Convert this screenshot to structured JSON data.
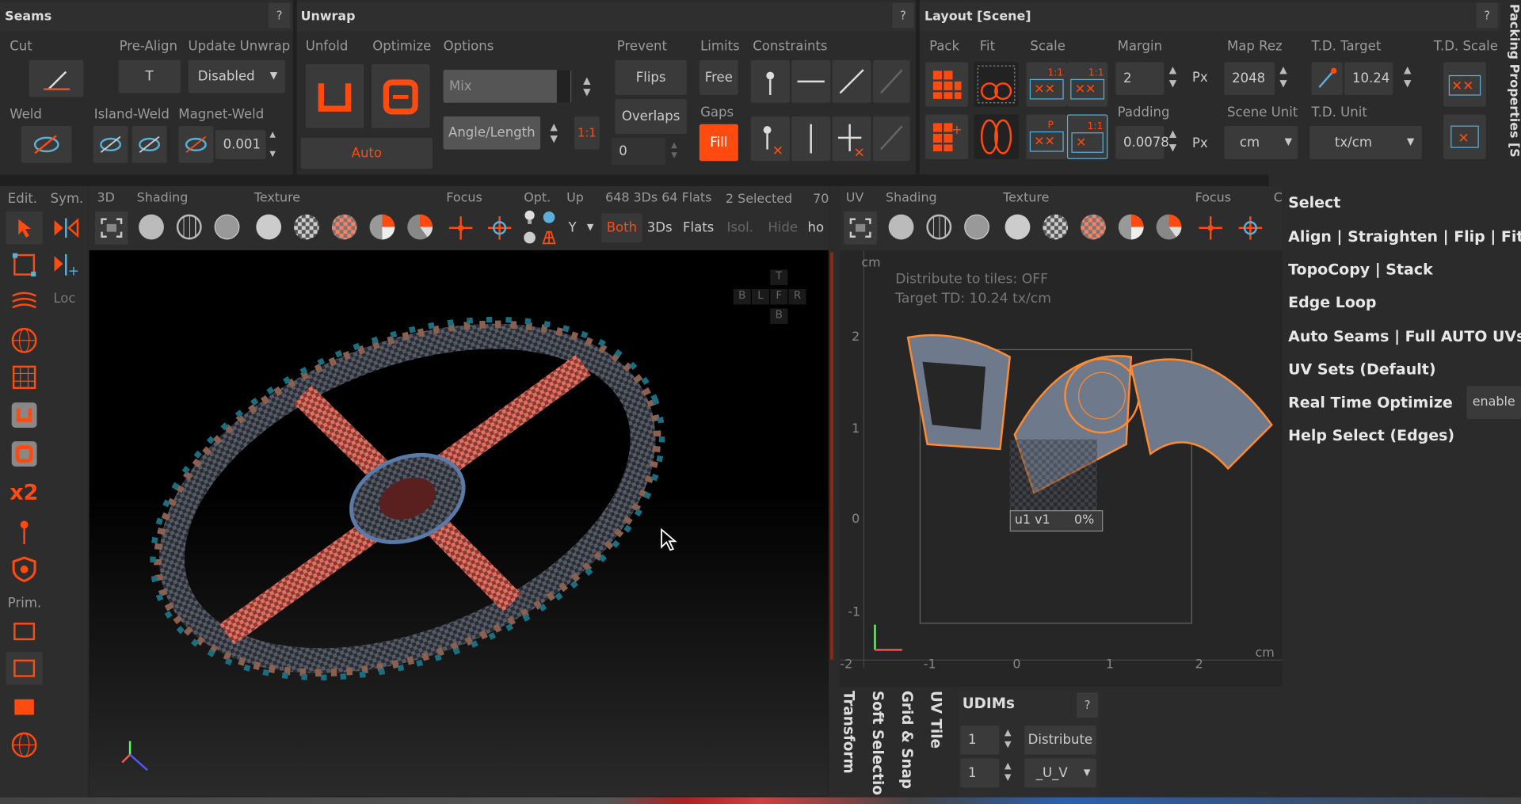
{
  "panels": {
    "seams": "Seams",
    "unwrap": "Unwrap",
    "layout": "Layout [Scene]",
    "packing": "Packing Properties [S",
    "help": "?"
  },
  "seams": {
    "cut": "Cut",
    "pre_align": "Pre-Align",
    "pre_align_value": "T",
    "update_unwrap": "Update Unwrap",
    "update_value": "Disabled",
    "weld": "Weld",
    "island_weld": "Island-Weld",
    "magnet_weld": "Magnet-Weld",
    "magnet_value": "0.001"
  },
  "unwrap": {
    "unfold": "Unfold",
    "optimize": "Optimize",
    "options": "Options",
    "mix": "Mix",
    "angle_length": "Angle/Length",
    "ratio": "1:1",
    "auto": "Auto",
    "prevent": "Prevent",
    "flips": "Flips",
    "overlaps": "Overlaps",
    "prevent_value": "0",
    "limits": "Limits",
    "free": "Free",
    "gaps": "Gaps",
    "fill": "Fill",
    "constraints": "Constraints"
  },
  "layout": {
    "pack": "Pack",
    "fit": "Fit",
    "scale": "Scale",
    "margin": "Margin",
    "margin_value": "2",
    "px": "Px",
    "map_rez": "Map Rez",
    "map_rez_value": "2048",
    "td_target": "T.D. Target",
    "td_target_value": "10.24",
    "td_scale": "T.D. Scale",
    "padding": "Padding",
    "padding_value": "0.0078",
    "scene_unit": "Scene Unit",
    "scene_unit_value": "cm",
    "td_unit": "T.D. Unit",
    "td_unit_value": "tx/cm",
    "badge_11": "1:1",
    "badge_p": "P"
  },
  "left_toolbar": {
    "edit": "Edit.",
    "sym": "Sym.",
    "loc": "Loc",
    "prim": "Prim.",
    "x2": "x2"
  },
  "viewport3d": {
    "tabs": [
      "3D",
      "Shading",
      "Texture",
      "Focus",
      "Opt.",
      "Up"
    ],
    "stats": "648 3Ds 64 Flats",
    "selected": "2 Selected",
    "extra": "70",
    "up_value": "Y",
    "both": "Both",
    "threeds": "3Ds",
    "flats": "Flats",
    "isol": "Isol.",
    "hide": "Hide",
    "how": "ho",
    "cube": {
      "t": "T",
      "b_left": "B",
      "l": "L",
      "f": "F",
      "r": "R",
      "b": "B"
    }
  },
  "viewportuv": {
    "tabs": [
      "UV",
      "Shading",
      "Texture",
      "Focus",
      "C"
    ],
    "distribute": "Distribute to tiles: OFF",
    "target_td": "Target TD: 10.24 tx/cm",
    "unit": "cm",
    "tile_label": "u1 v1",
    "tile_percent": "0%",
    "y_ticks": [
      "2",
      "1",
      "0",
      "-1"
    ],
    "x_ticks": [
      "-2",
      "-1",
      "0",
      "1",
      "2"
    ],
    "unit_x": "cm"
  },
  "right_menu": {
    "items": [
      "Select",
      "Align | Straighten | Flip | Fit",
      "TopoCopy | Stack",
      "Edge Loop",
      "Auto Seams | Full AUTO UVs",
      "UV Sets (Default)",
      "Real Time Optimize",
      "Help Select (Edges)"
    ],
    "enable": "enable"
  },
  "bottom_tabs": [
    "Transform",
    "Soft Selectio",
    "Grid & Snap",
    "UV Tile"
  ],
  "udims": {
    "title": "UDIMs",
    "v1": "1",
    "v2": "1",
    "distribute": "Distribute",
    "uv": "_U_V"
  },
  "colors": {
    "accent": "#ff4a10",
    "bg": "#2b2b2b",
    "dark": "#000000"
  }
}
